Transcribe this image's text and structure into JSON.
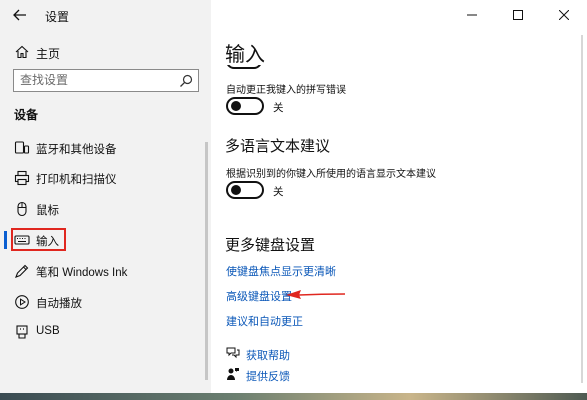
{
  "window": {
    "title": "设置",
    "controls": {
      "minimize": "—",
      "maximize": "☐",
      "close": "✕"
    }
  },
  "sidebar": {
    "home_label": "主页",
    "search_placeholder": "查找设置",
    "section_header": "设备",
    "items": [
      {
        "label": "蓝牙和其他设备",
        "icon": "bluetooth-devices-icon",
        "selected": false
      },
      {
        "label": "打印机和扫描仪",
        "icon": "printer-icon",
        "selected": false
      },
      {
        "label": "鼠标",
        "icon": "mouse-icon",
        "selected": false
      },
      {
        "label": "输入",
        "icon": "keyboard-icon",
        "selected": true
      },
      {
        "label": "笔和 Windows Ink",
        "icon": "pen-icon",
        "selected": false
      },
      {
        "label": "自动播放",
        "icon": "autoplay-icon",
        "selected": false
      },
      {
        "label": "USB",
        "icon": "usb-icon",
        "selected": false
      }
    ]
  },
  "main": {
    "page_title": "输入",
    "autocorrect": {
      "description": "自动更正我键入的拼写错误",
      "toggle_state": "关"
    },
    "multilang": {
      "title": "多语言文本建议",
      "description": "根据识别到的你键入所使用的语言显示文本建议",
      "toggle_state": "关"
    },
    "more_keyboard": {
      "title": "更多键盘设置",
      "links": [
        "使键盘焦点显示更清晰",
        "高级键盘设置",
        "建议和自动更正"
      ]
    },
    "help": {
      "get_help": "获取帮助",
      "feedback": "提供反馈"
    }
  },
  "colors": {
    "link": "#0a57b8",
    "annotation_red": "#e0271f",
    "selection_accent": "#0a5fd1",
    "sidebar_bg": "#f2f2f2"
  }
}
